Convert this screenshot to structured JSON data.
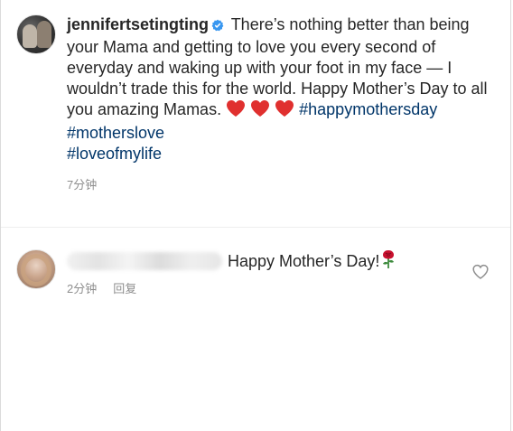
{
  "post": {
    "username": "jennifertsetingting",
    "verified_icon": "verified-badge-icon",
    "caption_line1": "There’s nothing better than being your Mama and getting to love you every second of everyday and waking up with your foot in my face — I wouldn’t trade this for the world. Happy Mother’s Day to all you amazing Mamas.",
    "hashtags": [
      "#happymothersday",
      "#motherslove",
      "#loveofmylife"
    ],
    "timestamp": "7分钟"
  },
  "comment": {
    "username_blurred": true,
    "text": "Happy Mother’s Day!",
    "emoji_icon": "rose-icon",
    "timestamp": "2分钟",
    "reply_label": "回复",
    "like_icon": "heart-outline-icon"
  },
  "colors": {
    "hashtag": "#003569",
    "meta": "#8e8e8e",
    "verified": "#3897f0",
    "heart": "#ed4956"
  }
}
